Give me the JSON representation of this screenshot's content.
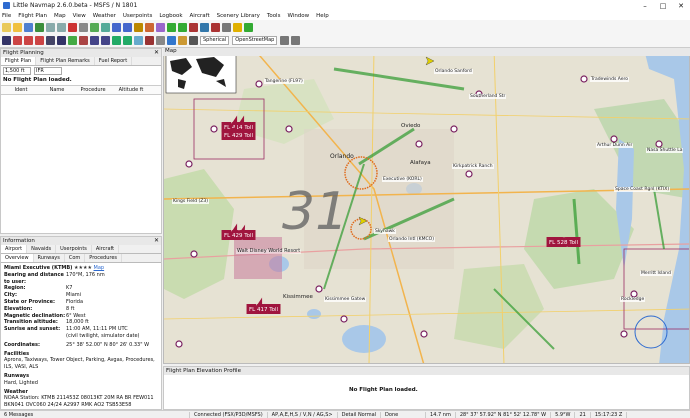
{
  "window": {
    "title": "Little Navmap 2.6.0.beta - MSFS / N 1801"
  },
  "menu": [
    "File",
    "Flight Plan",
    "Map",
    "View",
    "Weather",
    "Userpoints",
    "Logbook",
    "Aircraft",
    "Scenery Library",
    "Tools",
    "Window",
    "Help"
  ],
  "toolbar": {
    "projection": "Spherical",
    "theme": "OpenStreetMap"
  },
  "flight_planning": {
    "title": "Flight Planning",
    "tabs": [
      "Flight Plan",
      "Flight Plan Remarks",
      "Fuel Report"
    ],
    "altitude": "1,500 ft",
    "rules": "IFR",
    "message": "No Flight Plan loaded.",
    "columns": [
      "Ident",
      "Name",
      "Procedure",
      "Altitude ft"
    ]
  },
  "information": {
    "title": "Information",
    "tabs": [
      "Airport",
      "Navaids",
      "Userpoints",
      "Aircraft"
    ],
    "subtabs": [
      "Overview",
      "Runways",
      "Com",
      "Procedures"
    ],
    "airport_name": "Miami Executive (KTMB)",
    "stars": "★★★★",
    "map_link": "Map",
    "rows": [
      {
        "k": "Bearing and distance to user:",
        "v": "170°M, 176 nm"
      },
      {
        "k": "Region:",
        "v": "K7"
      },
      {
        "k": "City:",
        "v": "Miami"
      },
      {
        "k": "State or Province:",
        "v": "Florida"
      },
      {
        "k": "Elevation:",
        "v": "8 ft"
      },
      {
        "k": "Magnetic declination:",
        "v": "6° West"
      },
      {
        "k": "Transition altitude:",
        "v": "18,000 ft"
      },
      {
        "k": "Sunrise and sunset:",
        "v": "11:00 AM, 11:11 PM UTC"
      },
      {
        "k": "",
        "v": "(civil twilight, simulator date)"
      },
      {
        "k": "Coordinates:",
        "v": "25° 38' 52.00\" N 80° 26' 0.33\" W"
      }
    ],
    "facilities_title": "Facilities",
    "facilities": "Aprons, Taxiways, Tower Object, Parking, Avgas, Procedures, ILS, VASI, ALS",
    "runways_title": "Runways",
    "runways": "Hard, Lighted",
    "weather_title": "Weather",
    "weather": "NOAA Station: KTMB 211453Z 08013KT 20M RA BR FEW011 BKN041 OVC060 24/24 A2997 RMK AO2 TSB53E58"
  },
  "map": {
    "title": "Map"
  },
  "elevation_profile": {
    "title": "Flight Plan Elevation Profile",
    "message": "No Flight Plan loaded."
  },
  "map_labels": [
    "Tangerine (FL97)",
    "Orlando Sanford",
    "Tradewinds Aero",
    "Southerland Str",
    "Arthur Dunn Air",
    "Nasa Shuttle La",
    "Executive (KORL)",
    "Kirkpatrick Ranch",
    "Space Coast Rgnl (KTIX)",
    "Orlando Intl (KMCO)",
    "Skyhawk",
    "Kings Field (Z3)",
    "Walt Disney World Resort",
    "Kissimmee Gatew",
    "Merritt Island",
    "Rockledge",
    "Orlando",
    "Alafaya",
    "Oviedo",
    "Kissimmee"
  ],
  "airspace_labels": [
    "FL 414 Toll",
    "FL 429 Toll",
    "FL 417 Toll",
    "FL 528 Toll"
  ],
  "map_number": "31",
  "status": {
    "messages": "6 Messages",
    "connection": "Connected (FSX/P3D/MSFS)",
    "flags": "AP,A,E,H,S / V,N / AG,S>",
    "detail": "Detail Normal",
    "state": "Done",
    "distance": "14.7 nm",
    "coords": "28° 37' 57.92\" N 81° 52' 12.78\" W",
    "decl": "5.9°W",
    "time": "21",
    "clock": "15:17:23 Z"
  },
  "colors": {
    "accent": "#2e6bd0",
    "airport": "#7a2060",
    "airspace": "#a0153e"
  }
}
